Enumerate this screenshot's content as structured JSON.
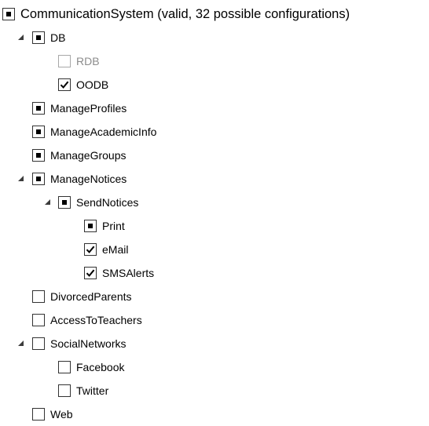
{
  "tree": {
    "root": {
      "label": "CommunicationSystem (valid, 32 possible configurations)",
      "state": "partial"
    },
    "items": [
      {
        "id": "db",
        "label": "DB",
        "state": "partial",
        "expanded": true
      },
      {
        "id": "rdb",
        "label": "RDB",
        "state": "unchecked",
        "disabled": true
      },
      {
        "id": "oodb",
        "label": "OODB",
        "state": "checked"
      },
      {
        "id": "manageprofiles",
        "label": "ManageProfiles",
        "state": "partial"
      },
      {
        "id": "manageacademicinfo",
        "label": "ManageAcademicInfo",
        "state": "partial"
      },
      {
        "id": "managegroups",
        "label": "ManageGroups",
        "state": "partial"
      },
      {
        "id": "managenotices",
        "label": "ManageNotices",
        "state": "partial",
        "expanded": true
      },
      {
        "id": "sendnotices",
        "label": "SendNotices",
        "state": "partial",
        "expanded": true
      },
      {
        "id": "print",
        "label": "Print",
        "state": "partial"
      },
      {
        "id": "email",
        "label": "eMail",
        "state": "checked"
      },
      {
        "id": "smsalerts",
        "label": "SMSAlerts",
        "state": "checked"
      },
      {
        "id": "divorcedparents",
        "label": "DivorcedParents",
        "state": "unchecked"
      },
      {
        "id": "accesstoteachers",
        "label": "AccessToTeachers",
        "state": "unchecked"
      },
      {
        "id": "socialnetworks",
        "label": "SocialNetworks",
        "state": "unchecked",
        "expanded": true
      },
      {
        "id": "facebook",
        "label": "Facebook",
        "state": "unchecked"
      },
      {
        "id": "twitter",
        "label": "Twitter",
        "state": "unchecked"
      },
      {
        "id": "web",
        "label": "Web",
        "state": "unchecked"
      }
    ]
  },
  "icons": {
    "expanded": "expanded-triangle-icon",
    "checked": "checkmark-icon",
    "partial": "partial-square-icon"
  },
  "colors": {
    "border": "#333333",
    "disabled_border": "#a8a8a8",
    "disabled_text": "#8c8c8c",
    "text": "#000000",
    "background": "#ffffff"
  }
}
